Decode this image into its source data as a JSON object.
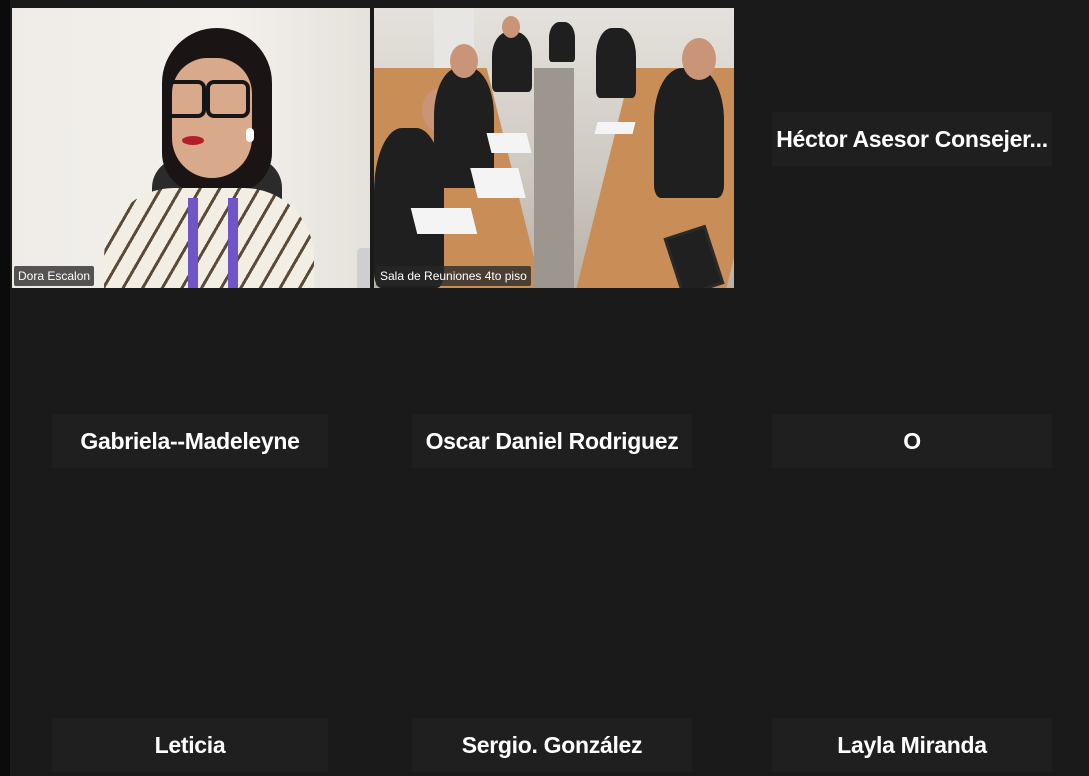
{
  "participants": {
    "dora": {
      "name": "Dora Escalon"
    },
    "room": {
      "name": "Sala de Reuniones 4to piso"
    },
    "hector": {
      "name": "Héctor Asesor Consejer..."
    },
    "gabriela": {
      "name": "Gabriela--Madeleyne"
    },
    "oscar": {
      "name": "Oscar Daniel Rodriguez"
    },
    "o": {
      "name": "O"
    },
    "leticia": {
      "name": "Leticia"
    },
    "sergio": {
      "name": "Sergio. González"
    },
    "layla": {
      "name": "Layla Miranda"
    }
  },
  "colors": {
    "background": "#1a1a1a",
    "name_card": "#1f1f1f",
    "label_overlay": "#282828",
    "text": "#ffffff"
  }
}
